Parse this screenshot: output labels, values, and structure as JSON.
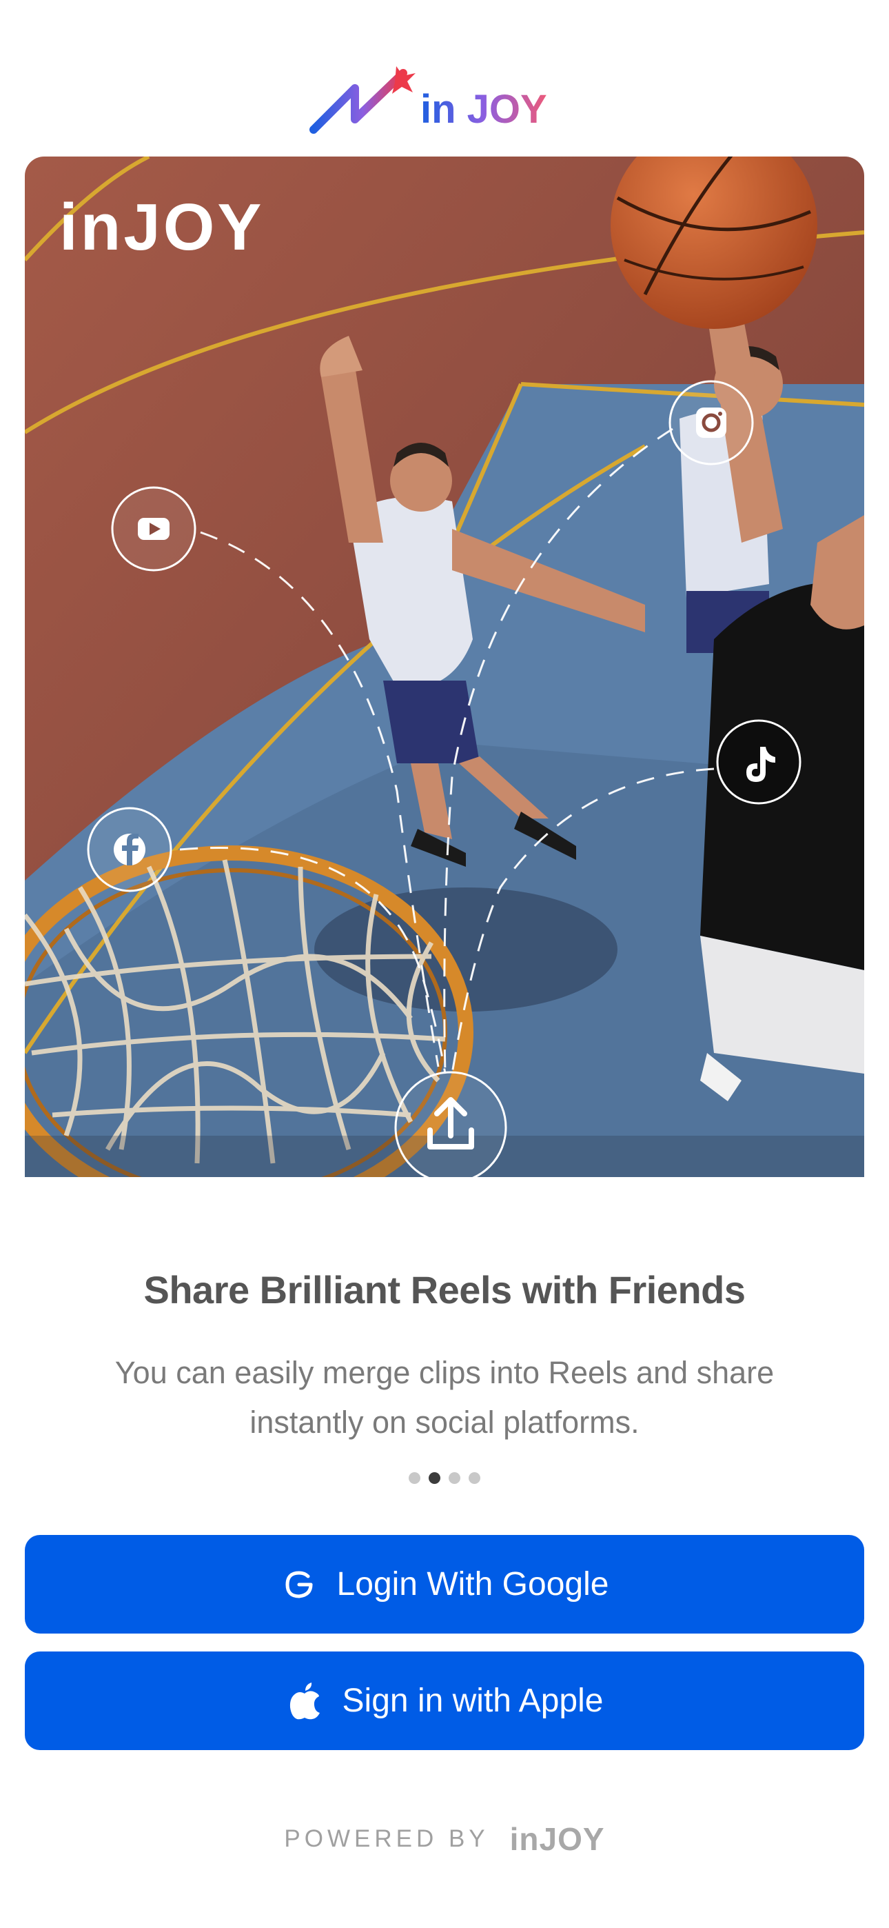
{
  "brand": {
    "name_prefix": "in",
    "name_suffix": "JOY",
    "logo_colors": {
      "blue": "#1f5fe0",
      "red": "#ec3a4a",
      "purple": "#8b5fe0"
    }
  },
  "hero": {
    "logo_text": "inJOY",
    "social_icons": [
      "youtube-icon",
      "instagram-icon",
      "facebook-icon",
      "tiktok-icon"
    ],
    "share_icon": "upload-icon"
  },
  "onboarding": {
    "title": "Share Brilliant Reels with Friends",
    "description": "You can easily merge clips into Reels and share instantly on social platforms.",
    "page_count": 4,
    "active_page": 2
  },
  "buttons": {
    "google_label": "Login With Google",
    "apple_label": "Sign in with Apple",
    "color": "#005ce6"
  },
  "footer": {
    "powered_by": "POWERED BY",
    "logo_text": "inJOY"
  }
}
